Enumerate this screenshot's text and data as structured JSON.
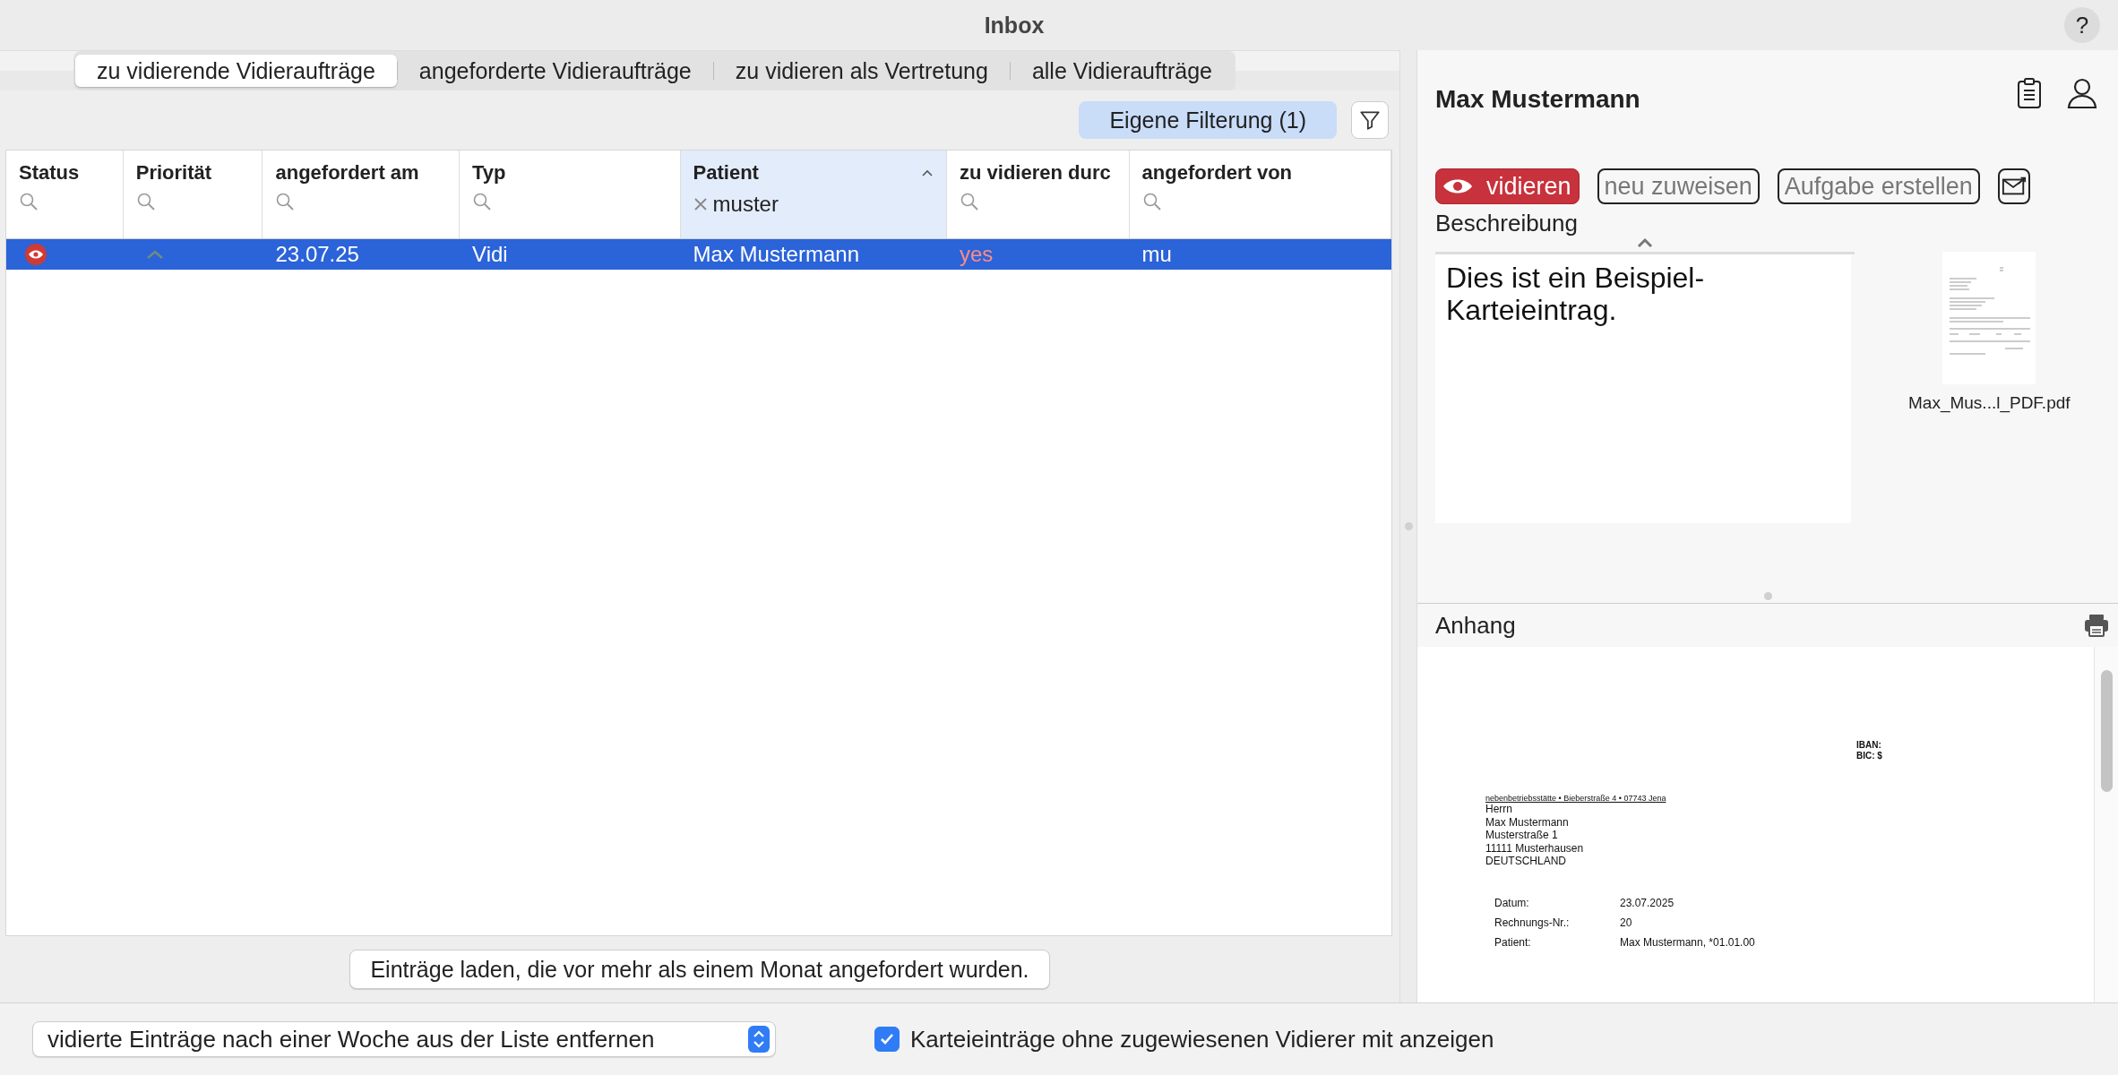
{
  "window": {
    "title": "Inbox",
    "help": "?"
  },
  "tabs": [
    {
      "label": "zu vidierende Vidieraufträge",
      "selected": true
    },
    {
      "label": "angeforderte Vidieraufträge",
      "selected": false
    },
    {
      "label": "zu vidieren als Vertretung",
      "selected": false
    },
    {
      "label": "alle Vidieraufträge",
      "selected": false
    }
  ],
  "filter_button": {
    "label": "Eigene Filterung (1)",
    "active": true
  },
  "table": {
    "columns": [
      {
        "label": "Status",
        "sorted": false
      },
      {
        "label": "Priorität",
        "sorted": false
      },
      {
        "label": "angefordert am",
        "sorted": false
      },
      {
        "label": "Typ",
        "sorted": false
      },
      {
        "label": "Patient",
        "sorted": true,
        "filter": "muster"
      },
      {
        "label": "zu vidieren durc",
        "sorted": false
      },
      {
        "label": "angefordert von",
        "sorted": false
      }
    ],
    "rows": [
      {
        "selected": true,
        "cells": [
          {
            "kind": "status"
          },
          {
            "kind": "priority"
          },
          {
            "kind": "text",
            "text": "23.07.25"
          },
          {
            "kind": "text",
            "text": "Vidi"
          },
          {
            "kind": "text",
            "text": "Max Mustermann"
          },
          {
            "kind": "alert",
            "text": "yes"
          },
          {
            "kind": "text",
            "text": "mu"
          }
        ]
      }
    ]
  },
  "load_button": "Einträge laden, die vor mehr als einem Monat angefordert wurden.",
  "bottom": {
    "select": "vidierte Einträge nach einer Woche aus der Liste entfernen",
    "checkbox": {
      "label": "Karteieinträge ohne zugewiesenen Vidierer mit anzeigen",
      "checked": true
    }
  },
  "detail": {
    "name": "Max Mustermann",
    "actions": [
      {
        "kind": "primary",
        "label": "vidieren"
      },
      {
        "kind": "outline",
        "label": "neu zuweisen"
      },
      {
        "kind": "outline",
        "label": "Aufgabe erstellen"
      },
      {
        "kind": "mail"
      }
    ],
    "description_label": "Beschreibung",
    "description": "Dies ist ein Beispiel-Karteieintrag.",
    "file_name": "Max_Mus...l_PDF.pdf",
    "attachment": {
      "title": "Anhang",
      "bank": [
        "IBAN:",
        "BIC: $"
      ],
      "sender": "nebenbetriebsstätte • Bieberstraße 4 • 07743 Jena",
      "address": [
        "Herrn",
        "Max Mustermann",
        "Musterstraße 1",
        "11111 Musterhausen",
        "DEUTSCHLAND"
      ],
      "fields": [
        {
          "label": "Datum:",
          "value": "23.07.2025"
        },
        {
          "label": "Rechnungs-Nr.:",
          "value": "20"
        },
        {
          "label": "Patient:",
          "value": "Max Mustermann, *01.01.00"
        }
      ]
    }
  }
}
